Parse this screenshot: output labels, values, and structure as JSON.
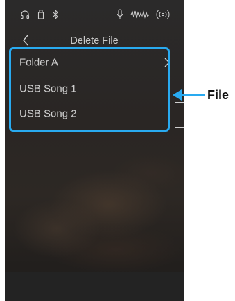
{
  "status_bar": {
    "headphones_icon": "headphones-icon",
    "usb_icon": "usb-icon",
    "bluetooth_icon": "bluetooth-icon",
    "mic_icon": "microphone-icon",
    "audio_icon": "audio-waveform-icon",
    "wireless_icon": "wireless-icon"
  },
  "header": {
    "title": "Delete File",
    "back_icon": "chevron-left-icon"
  },
  "file_list": {
    "items": [
      {
        "label": "Folder A",
        "has_chevron": true
      },
      {
        "label": "USB Song 1",
        "has_chevron": false
      },
      {
        "label": "USB Song 2",
        "has_chevron": false
      }
    ]
  },
  "callout": {
    "label": "File",
    "color": "#29aaf0"
  }
}
